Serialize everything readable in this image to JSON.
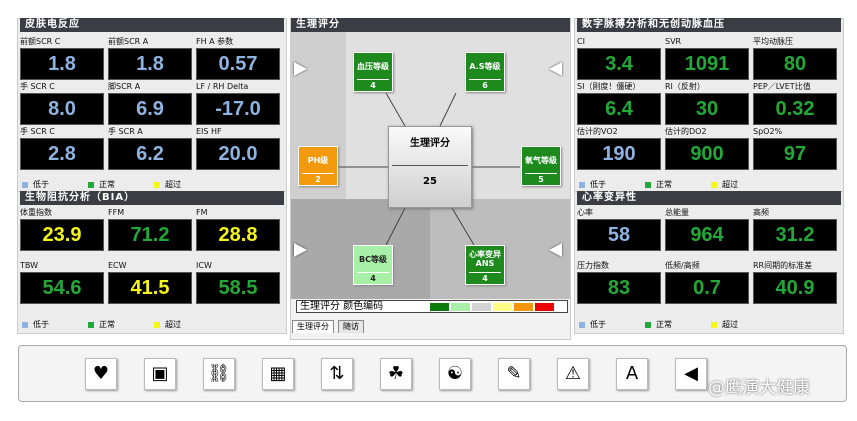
{
  "colors": {
    "low": "#8fb3e0",
    "normal": "#22a838",
    "over": "#f5f51a",
    "header": "#3c3d44"
  },
  "legend": {
    "low": "低于",
    "normal": "正常",
    "over": "超过"
  },
  "gsr": {
    "title": "皮肤电反应",
    "cells": [
      {
        "label": "前额SCR C",
        "value": "1.8",
        "status": "low"
      },
      {
        "label": "前额SCR A",
        "value": "1.8",
        "status": "low"
      },
      {
        "label": "FH A 参数",
        "value": "0.57",
        "status": "low"
      },
      {
        "label": "手 SCR C",
        "value": "8.0",
        "status": "low"
      },
      {
        "label": "脚SCR A",
        "value": "6.9",
        "status": "low"
      },
      {
        "label": "LF / RH Delta",
        "value": "-17.0",
        "status": "low"
      },
      {
        "label": "手 SCR C",
        "value": "2.8",
        "status": "low"
      },
      {
        "label": "手 SCR A",
        "value": "6.2",
        "status": "low"
      },
      {
        "label": "EIS HF",
        "value": "20.0",
        "status": "low"
      }
    ]
  },
  "bia": {
    "title": "生物阻抗分析（BIA）",
    "cells": [
      {
        "label": "体重指数",
        "value": "23.9",
        "status": "over"
      },
      {
        "label": "FFM",
        "value": "71.2",
        "status": "normal"
      },
      {
        "label": "FM",
        "value": "28.8",
        "status": "over"
      },
      {
        "label": "TBW",
        "value": "54.6",
        "status": "normal"
      },
      {
        "label": "ECW",
        "value": "41.5",
        "status": "over"
      },
      {
        "label": "ICW",
        "value": "58.5",
        "status": "normal"
      }
    ]
  },
  "pulse": {
    "title": "数字脉搏分析和无创动脉血压",
    "cells": [
      {
        "label": "CI",
        "value": "3.4",
        "status": "normal"
      },
      {
        "label": "SVR",
        "value": "1091",
        "status": "normal"
      },
      {
        "label": "平均动脉压",
        "value": "80",
        "status": "normal"
      },
      {
        "label": "SI（刚度！僵硬）",
        "value": "6.4",
        "status": "normal"
      },
      {
        "label": "RI（反射）",
        "value": "30",
        "status": "normal"
      },
      {
        "label": "PEP／LVET比值",
        "value": "0.32",
        "status": "normal"
      },
      {
        "label": "估计的VO2",
        "value": "190",
        "status": "low"
      },
      {
        "label": "估计的DO2",
        "value": "900",
        "status": "normal"
      },
      {
        "label": "SpO2%",
        "value": "97",
        "status": "normal"
      }
    ]
  },
  "hrv": {
    "title": "心率变异性",
    "cells": [
      {
        "label": "心率",
        "value": "58",
        "status": "low"
      },
      {
        "label": "总能量",
        "value": "964",
        "status": "normal"
      },
      {
        "label": "高频",
        "value": "31.2",
        "status": "normal"
      },
      {
        "label": "压力指数",
        "value": "83",
        "status": "normal"
      },
      {
        "label": "低频/高频",
        "value": "0.7",
        "status": "normal"
      },
      {
        "label": "RR间期的标准差",
        "value": "40.9",
        "status": "normal"
      }
    ]
  },
  "score": {
    "title": "生理评分",
    "center_label": "生理评分",
    "center_value": "25",
    "nodes": [
      {
        "label": "血压等级",
        "value": "4",
        "color": "#1e8a1e"
      },
      {
        "label": "A.S等级",
        "value": "6",
        "color": "#1e8a1e"
      },
      {
        "label": "PH级",
        "value": "2",
        "color": "#f29a0c"
      },
      {
        "label": "氧气等级",
        "value": "5",
        "color": "#1e8a1e"
      },
      {
        "label": "BC等级",
        "value": "4",
        "color": "#a8f0a8"
      },
      {
        "label": "心率变异",
        "sub": "ANS",
        "value": "4",
        "color": "#1e8a1e"
      }
    ],
    "color_code_label": "生理评分 颜色编码",
    "color_code": [
      "#0a7a0a",
      "#a8f0a8",
      "#d3d3d3",
      "#ffff88",
      "#f5960a",
      "#ee0000"
    ],
    "tabs": [
      "生理评分",
      "随访"
    ]
  },
  "toolbar": {
    "icons": [
      "heart-icon",
      "therapy-photo-icon",
      "chain-link-icon",
      "brain-image-icon",
      "up-down-arrows-icon",
      "meditation-icon",
      "yin-yang-icon",
      "tooth-pen-icon",
      "warning-icon",
      "pdf-icon",
      "back-icon"
    ],
    "glyphs": [
      "♥",
      "▣",
      "⛓",
      "▦",
      "⇅",
      "☘",
      "☯",
      "✎",
      "⚠",
      "A",
      "◀"
    ]
  },
  "watermark": "@鹰演大健康"
}
